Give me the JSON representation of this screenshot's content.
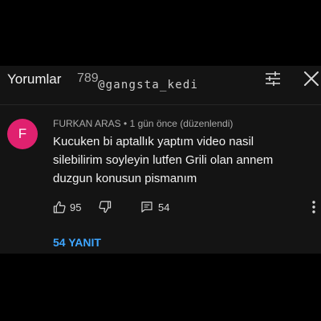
{
  "header": {
    "title": "Yorumlar",
    "count": "789",
    "watermark": "@gangsta_kedi",
    "icons": {
      "sort": "sort-sliders-icon",
      "close": "close-icon"
    }
  },
  "comment": {
    "avatar_letter": "F",
    "avatar_color": "#e0216f",
    "author": "FURKAN ARAS",
    "separator": "•",
    "time": "1 gün önce",
    "edited": "(düzenlendi)",
    "text": "Kucuken bi aptallık yaptım video nasil silebilirim soyleyin lutfen Grili olan annem duzgun konusun pismanım",
    "likes": "95",
    "reply_count": "54",
    "icons": {
      "like": "thumbs-up-icon",
      "dislike": "thumbs-down-icon",
      "reply": "reply-icon",
      "more": "more-vertical-icon"
    }
  },
  "replies_link": "54 YANIT",
  "colors": {
    "background": "#000000",
    "panel": "#141414",
    "text_primary": "#f1f1f1",
    "text_secondary": "#aaaaaa",
    "link": "#3ea6ff"
  }
}
